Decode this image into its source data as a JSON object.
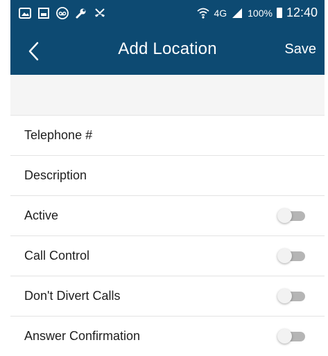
{
  "colors": {
    "appbar": "#0d4a72",
    "switch_track_off": "#b5b5b5",
    "switch_thumb_off": "#f2f2f2"
  },
  "status_bar": {
    "left_icons": [
      "image-notification-icon",
      "gallery-icon",
      "voicemail-icon",
      "wrench-icon",
      "missed-call-icon"
    ],
    "right_icons": [
      "wifi-icon",
      "signal-icon",
      "battery-icon"
    ],
    "network": "4G",
    "battery": "100%",
    "time": "12:40"
  },
  "toolbar": {
    "title": "Add Location",
    "save_label": "Save",
    "back_icon": "chevron-left-icon"
  },
  "form": {
    "fields": [
      {
        "label": "Telephone #"
      },
      {
        "label": "Description"
      }
    ],
    "toggles": [
      {
        "label": "Active",
        "on": false
      },
      {
        "label": "Call Control",
        "on": false
      },
      {
        "label": "Don't Divert Calls",
        "on": false
      },
      {
        "label": "Answer Confirmation",
        "on": false
      }
    ]
  }
}
